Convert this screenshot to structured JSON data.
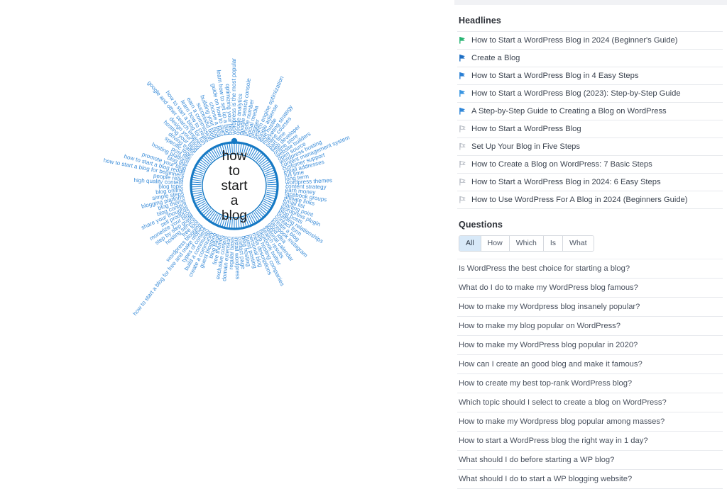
{
  "viz": {
    "center_label": "how to start a blog",
    "center_lines": [
      "how",
      "to",
      "start",
      "a",
      "blog"
    ],
    "accent_color": "#1679c4",
    "label_color": "#3d8ed9",
    "tick_count": 110,
    "spokes": [
      "wordpress is the most popular",
      "google analytics",
      "google search console",
      "phone number",
      "social media",
      "blogger",
      "search engine optimization",
      "google adsense",
      "side hustle",
      "marketing strategy",
      "online courses",
      "part time",
      "web developer",
      "online store",
      "website builders",
      "open source",
      "wordpress hosting",
      "content management system",
      "customer support",
      "email addresses",
      "full time",
      "long term",
      "wordpress themes",
      "content strategy",
      "earn money",
      "facebook groups",
      "affiliate links",
      "email list",
      "starting point",
      "wordpress plugin",
      "blog posts",
      "building relationships",
      "contact form",
      "create a blog",
      "facebook instagram",
      "good idea",
      "editorial calendar",
      "search results",
      "facebook twitter",
      "web hosting companies",
      "meta descriptions",
      "personal blog",
      "guest posting",
      "blog hosting",
      "contact page",
      "install wordpress",
      "regular basis",
      "domain extension",
      "exclusive content",
      "free themes",
      "blog page",
      "guest blogging",
      "create a community",
      "build a community",
      "types of content",
      "how to start a blog for free and make money",
      "wordpress blogging",
      "free tool",
      "hosting service",
      "step by step guide",
      "monetize your blog",
      "sell products",
      "share your thoughts",
      "blog content",
      "blog theme",
      "blogging platform",
      "simple steps",
      "blog online",
      "blog topic",
      "high quality content",
      "people read",
      "how to start a blog for beginners",
      "how to start a blog reddit",
      "promote your blog",
      "blog title",
      "hosting platform",
      "post title",
      "specific topic",
      "driving traffic",
      "hosting your blog",
      "design your blog",
      "google and other search engines",
      "how to start a blog for fun",
      "learn how to create",
      "earn a commission",
      "successful blog",
      "building your blog",
      "choose a blog",
      "guide on how to start",
      "learn how to set up a blog",
      "optimizing your blog"
    ]
  },
  "headlines": {
    "title": "Headlines",
    "items": [
      {
        "text": "How to Start a WordPress Blog in 2024 (Beginner's Guide)",
        "flag": "flag-icon",
        "flag_color": "#29b473",
        "filled": true
      },
      {
        "text": "Create a Blog",
        "flag": "flag-icon",
        "flag_color": "#1e6fc4",
        "filled": true
      },
      {
        "text": "How to Start a WordPress Blog in 4 Easy Steps",
        "flag": "flag-icon",
        "flag_color": "#2a7fd4",
        "filled": true
      },
      {
        "text": "How to Start a WordPress Blog (2023): Step-by-Step Guide",
        "flag": "flag-icon",
        "flag_color": "#3a96e2",
        "filled": true
      },
      {
        "text": "A Step-by-Step Guide to Creating a Blog on WordPress",
        "flag": "flag-icon",
        "flag_color": "#2f86d8",
        "filled": true
      },
      {
        "text": "How to Start a WordPress Blog",
        "flag": "flag-icon",
        "flag_color": "#b9bec6",
        "filled": false
      },
      {
        "text": "Set Up Your Blog in Five Steps",
        "flag": "flag-icon",
        "flag_color": "#b9bec6",
        "filled": false
      },
      {
        "text": "How to Create a Blog on WordPress: 7 Basic Steps",
        "flag": "flag-icon",
        "flag_color": "#b9bec6",
        "filled": false
      },
      {
        "text": "How to Start a WordPress Blog in 2024: 6 Easy Steps",
        "flag": "flag-icon",
        "flag_color": "#b9bec6",
        "filled": false
      },
      {
        "text": "How to Use WordPress For A Blog in 2024 (Beginners Guide)",
        "flag": "flag-icon",
        "flag_color": "#b9bec6",
        "filled": false
      }
    ]
  },
  "questions": {
    "title": "Questions",
    "tabs": [
      {
        "label": "All",
        "active": true
      },
      {
        "label": "How",
        "active": false
      },
      {
        "label": "Which",
        "active": false
      },
      {
        "label": "Is",
        "active": false
      },
      {
        "label": "What",
        "active": false
      }
    ],
    "items": [
      "Is WordPress the best choice for starting a blog?",
      "What do I do to make my WordPress blog famous?",
      "How to make my Wordpress blog insanely popular?",
      "How to make my blog popular on WordPress?",
      "How to make my WordPress blog popular in 2020?",
      "How can I create an good blog and make it famous?",
      "How to create my best top-rank WordPress blog?",
      "Which topic should I select to create a blog on WordPress?",
      "How to make my Wordpress blog popular among masses?",
      "How to start a WordPress blog the right way in 1 day?",
      "What should I do before starting a WP blog?",
      "What should I do to start a WP blogging website?"
    ]
  }
}
